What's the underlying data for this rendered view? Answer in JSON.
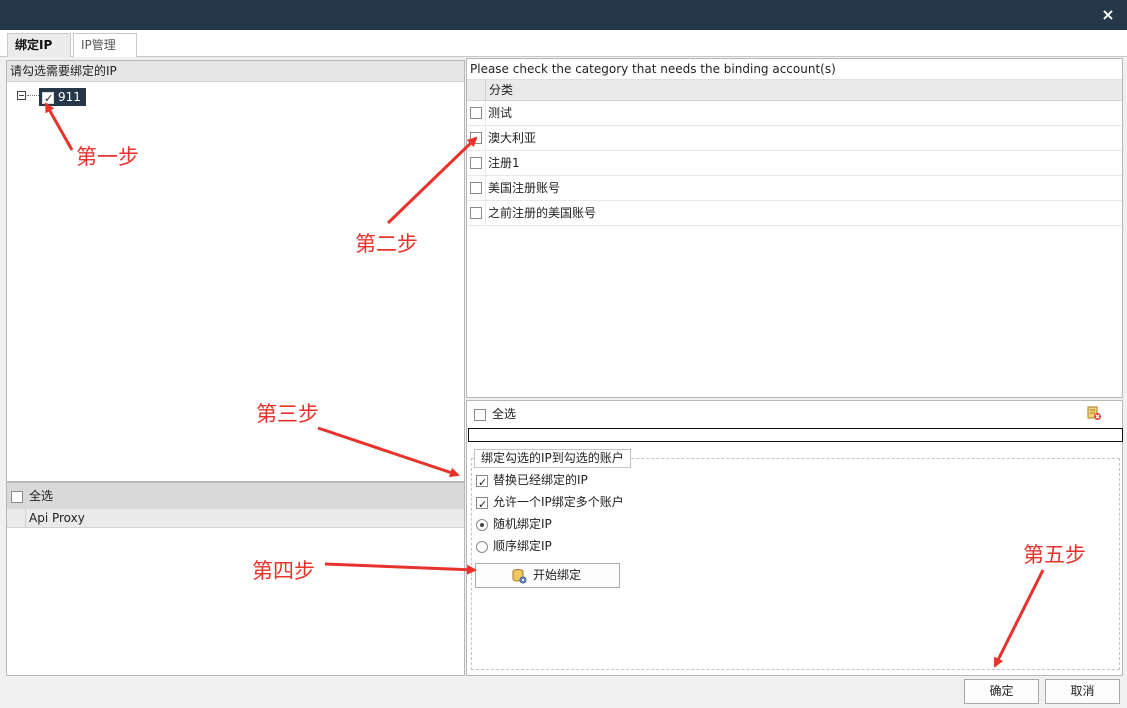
{
  "window": {
    "close_glyph": "×"
  },
  "tabs": [
    {
      "label": "绑定IP",
      "active": true
    },
    {
      "label": "IP管理",
      "active": false
    }
  ],
  "left_panel": {
    "header": "请勾选需要绑定的IP",
    "tree_items": [
      {
        "label": "911",
        "checked": true
      }
    ]
  },
  "proxy_panel": {
    "select_all_label": "全选",
    "column_header": "Api Proxy"
  },
  "category_panel": {
    "header": "Please check the category that needs the binding account(s)",
    "column_header": "分类",
    "rows": [
      {
        "label": "测试",
        "checked": false
      },
      {
        "label": "澳大利亚",
        "checked": false
      },
      {
        "label": "注册1",
        "checked": false
      },
      {
        "label": "美国注册账号",
        "checked": false
      },
      {
        "label": "之前注册的美国账号",
        "checked": false
      }
    ],
    "select_all_label": "全选",
    "clear_icon": "clear-selection-icon"
  },
  "bind_group": {
    "legend": "绑定勾选的IP到勾选的账户",
    "options": {
      "replace_bound": {
        "label": "替换已经绑定的IP",
        "checked": true
      },
      "allow_multiple": {
        "label": "允许一个IP绑定多个账户",
        "checked": true
      },
      "random_bind": {
        "label": "随机绑定IP",
        "selected": true
      },
      "sequential_bind": {
        "label": "顺序绑定IP",
        "selected": false
      }
    },
    "start_button": "开始绑定",
    "start_icon": "bind-database-icon"
  },
  "footer": {
    "ok_label": "确定",
    "cancel_label": "取消"
  },
  "annotations": {
    "step1": "第一步",
    "step2": "第二步",
    "step3": "第三步",
    "step4": "第四步",
    "step5": "第五步",
    "color": "#e8332c"
  },
  "colors": {
    "titlebar": "#25384a",
    "tree_selection": "#253748"
  }
}
